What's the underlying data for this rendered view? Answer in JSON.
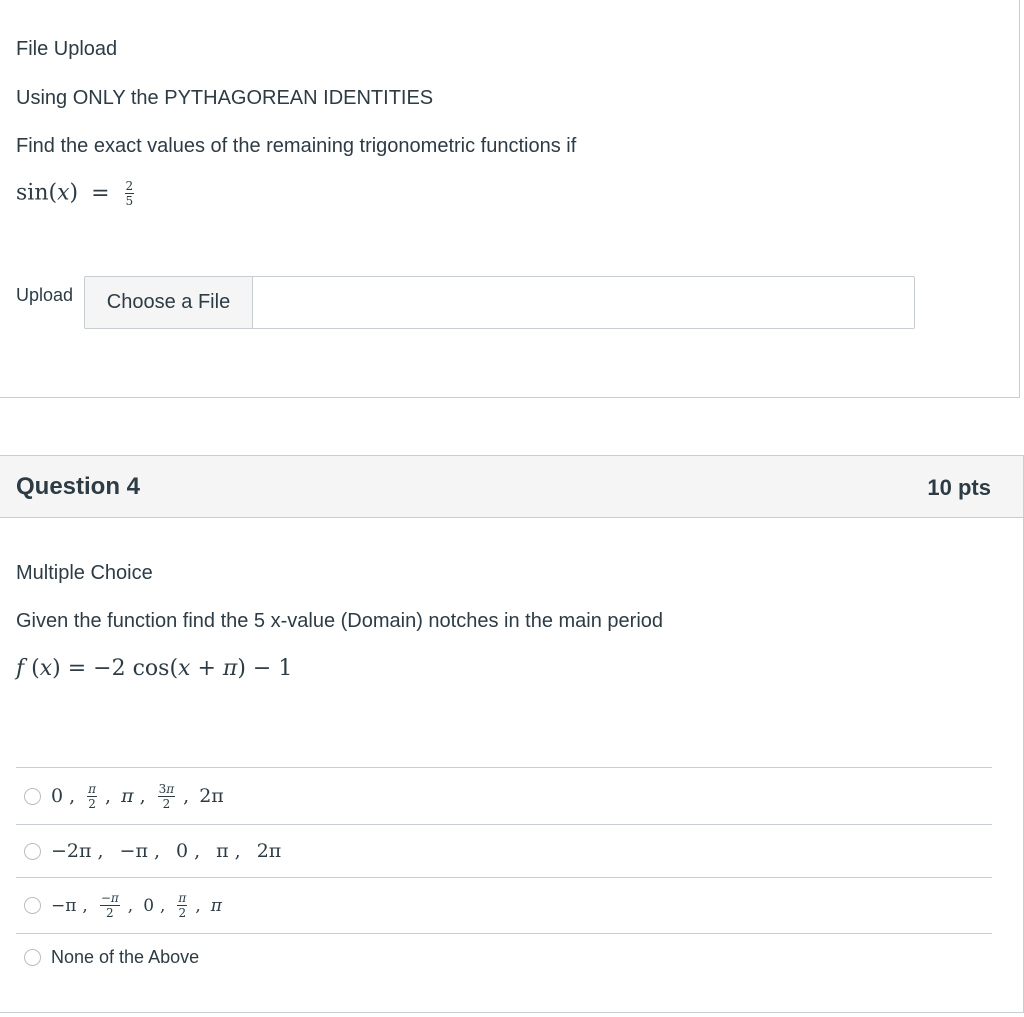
{
  "question3": {
    "type_label": "File Upload",
    "instruction": "Using ONLY the PYTHAGOREAN IDENTITIES",
    "prompt": "Find the exact values of the remaining trigonometric functions if",
    "equation": {
      "fn": "sin",
      "var": "x",
      "equals": "=",
      "numerator": "2",
      "denominator": "5"
    },
    "upload_label": "Upload",
    "choose_button": "Choose a File"
  },
  "question4": {
    "title": "Question 4",
    "points": "10 pts",
    "type_label": "Multiple Choice",
    "prompt": "Given the function find the 5 x-value (Domain) notches in the main period",
    "equation": "f (x) = −2 cos(x + π) − 1",
    "answers": [
      {
        "terms": [
          "0",
          "π/2",
          "π",
          "3π/2",
          "2π"
        ]
      },
      {
        "terms": [
          "−2π",
          "−π",
          "0",
          "π",
          "2π"
        ]
      },
      {
        "terms": [
          "−π",
          "−π/2",
          "0",
          "π/2",
          "π"
        ]
      },
      {
        "text": "None of the Above"
      }
    ]
  }
}
